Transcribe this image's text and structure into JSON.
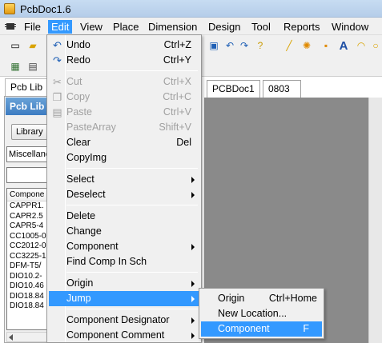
{
  "window": {
    "title": "PcbDoc1.6"
  },
  "menubar": {
    "items": [
      {
        "label": "File"
      },
      {
        "label": "Edit"
      },
      {
        "label": "View"
      },
      {
        "label": "Place"
      },
      {
        "label": "Dimension"
      },
      {
        "label": "Design"
      },
      {
        "label": "Tool"
      },
      {
        "label": "Reports"
      },
      {
        "label": "Window"
      }
    ]
  },
  "left_panel": {
    "tab_label": "Pcb Lib",
    "header": "Pcb Lib",
    "library_button": "Library",
    "library_select": "Miscellane",
    "list_header": "Compone",
    "components": [
      "CAPPR1.",
      "CAPR2.5",
      "CAPR5-4",
      "CC1005-0",
      "CC2012-0",
      "CC3225-1",
      "DFM-T5/",
      "DIO10.2-",
      "DIO10.46",
      "DIO18.84",
      "DIO18.84"
    ]
  },
  "doc_tabs": [
    "PCBDoc1",
    "0803"
  ],
  "edit_menu": {
    "items": [
      {
        "label": "Undo",
        "shortcut": "Ctrl+Z",
        "icon": "undo-icon"
      },
      {
        "label": "Redo",
        "shortcut": "Ctrl+Y",
        "icon": "redo-icon"
      },
      {
        "label": "Cut",
        "shortcut": "Ctrl+X",
        "icon": "cut-icon"
      },
      {
        "label": "Copy",
        "shortcut": "Ctrl+C",
        "icon": "copy-icon"
      },
      {
        "label": "Paste",
        "shortcut": "Ctrl+V",
        "icon": "paste-icon"
      },
      {
        "label": "PasteArray",
        "shortcut": "Shift+V"
      },
      {
        "label": "Clear",
        "shortcut": "Del"
      },
      {
        "label": "CopyImg",
        "shortcut": ""
      },
      {
        "label": "Select"
      },
      {
        "label": "Deselect"
      },
      {
        "label": "Delete"
      },
      {
        "label": "Change"
      },
      {
        "label": "Component"
      },
      {
        "label": "Find Comp In Sch"
      },
      {
        "label": "Origin"
      },
      {
        "label": "Jump"
      },
      {
        "label": "Component Designator"
      },
      {
        "label": "Component Comment"
      }
    ]
  },
  "jump_submenu": {
    "items": [
      {
        "label": "Origin",
        "shortcut": "Ctrl+Home"
      },
      {
        "label": "New Location...",
        "shortcut": ""
      },
      {
        "label": "Component",
        "shortcut": "F"
      }
    ]
  },
  "colors": {
    "highlight": "#3399ff",
    "menu_bg": "#f0f0f0",
    "titlebar": "#c7dcf2",
    "workspace": "#8a8a8a"
  }
}
